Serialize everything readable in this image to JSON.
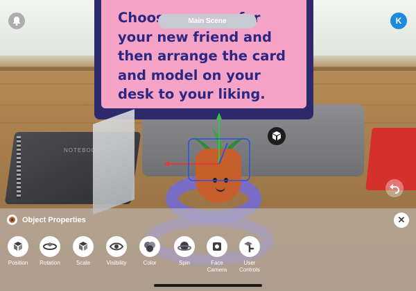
{
  "header": {
    "scene_label": "Main Scene",
    "bell_icon": "bell-icon",
    "profile_initial": "K"
  },
  "card": {
    "lines": [
      "Choose a name for",
      "your new friend and",
      "then arrange the card",
      "and model on your",
      "desk to your liking."
    ]
  },
  "backdrop": {
    "notebook_label": "NOTEBOOK"
  },
  "panel": {
    "title": "Object Properties",
    "tools": [
      {
        "label": "Position",
        "icon": "position-cube-icon"
      },
      {
        "label": "Rotation",
        "icon": "rotation-icon"
      },
      {
        "label": "Scale",
        "icon": "scale-cube-icon"
      },
      {
        "label": "Visibility",
        "icon": "eye-icon"
      },
      {
        "label": "Color",
        "icon": "color-circles-icon"
      },
      {
        "label": "Spin",
        "icon": "spin-icon"
      },
      {
        "label": "Face\nCamera",
        "icon": "face-camera-icon"
      },
      {
        "label": "User\nControls",
        "icon": "user-controls-icon"
      }
    ]
  },
  "colors": {
    "accent_blue": "#1f8ad8",
    "card_pink": "#f5a3c7",
    "card_text": "#2b2782",
    "gizmo_red": "#e23b3b",
    "gizmo_green": "#36c24a",
    "gizmo_blue": "#2b52e0",
    "ring_purple": "#6b68ee"
  }
}
